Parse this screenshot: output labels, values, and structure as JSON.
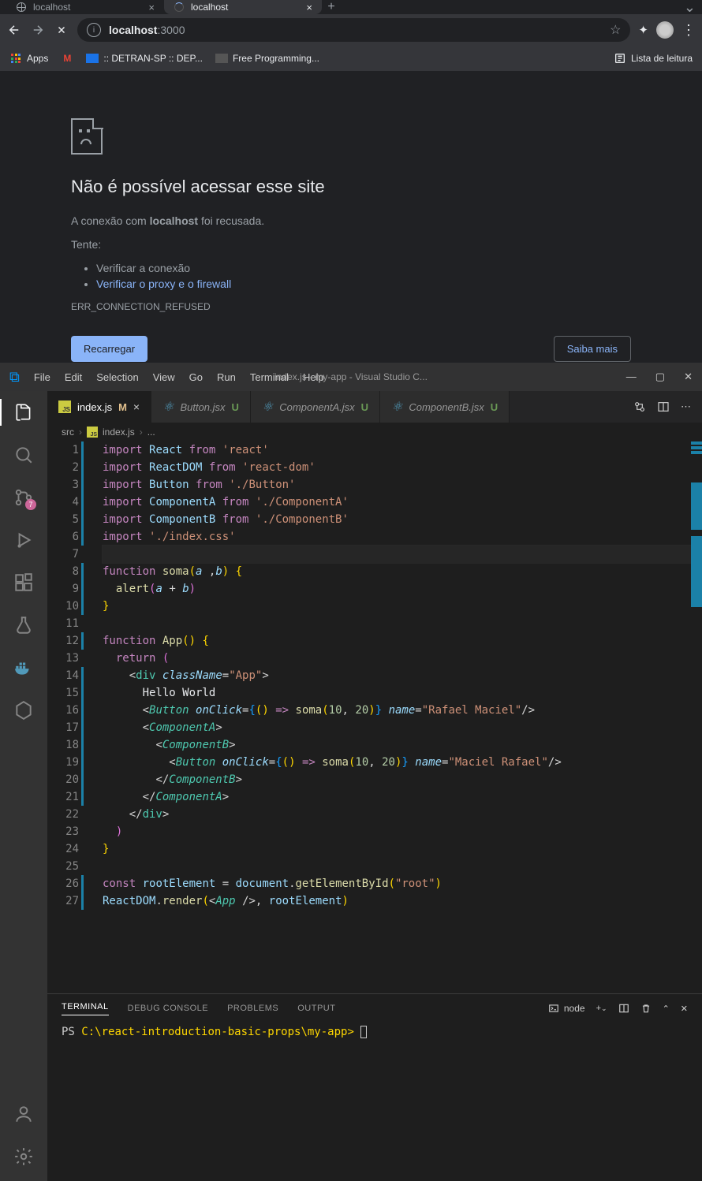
{
  "chrome": {
    "tabs": [
      {
        "title": "localhost",
        "active": false
      },
      {
        "title": "localhost",
        "active": true
      }
    ],
    "url_host": "localhost",
    "url_port": ":3000",
    "bookmarks": {
      "apps": "Apps",
      "detran": ":: DETRAN-SP :: DEP...",
      "freeprog": "Free Programming...",
      "readlist": "Lista de leitura"
    }
  },
  "error": {
    "title": "Não é possível acessar esse site",
    "msg_pre": "A conexão com ",
    "msg_host": "localhost",
    "msg_post": " foi recusada.",
    "try": "Tente:",
    "bullets": [
      "Verificar a conexão",
      "Verificar o proxy e o firewall"
    ],
    "code": "ERR_CONNECTION_REFUSED",
    "reload": "Recarregar",
    "more": "Saiba mais"
  },
  "vscode": {
    "menu": [
      "File",
      "Edit",
      "Selection",
      "View",
      "Go",
      "Run",
      "Terminal",
      "Help"
    ],
    "wintitle": "index.js - my-app - Visual Studio C...",
    "scm_badge": "7",
    "tabs": [
      {
        "name": "index.js",
        "status": "M",
        "active": true,
        "icon": "js"
      },
      {
        "name": "Button.jsx",
        "status": "U",
        "active": false,
        "icon": "react"
      },
      {
        "name": "ComponentA.jsx",
        "status": "U",
        "active": false,
        "icon": "react"
      },
      {
        "name": "ComponentB.jsx",
        "status": "U",
        "active": false,
        "icon": "react"
      }
    ],
    "breadcrumb": [
      "src",
      "index.js",
      "..."
    ],
    "terminal": {
      "tabs": [
        "TERMINAL",
        "DEBUG CONSOLE",
        "PROBLEMS",
        "OUTPUT"
      ],
      "shell": "node",
      "prompt_prefix": "PS ",
      "prompt_path": "C:\\react-introduction-basic-props\\my-app>"
    },
    "code_strings": {
      "react": "'react'",
      "reactdom": "'react-dom'",
      "button_path": "'./Button'",
      "compA_path": "'./ComponentA'",
      "compB_path": "'./ComponentB'",
      "css": "'./index.css'",
      "app_class": "\"App\"",
      "hello": "Hello World",
      "name1": "\"Rafael Maciel\"",
      "name2": "\"Maciel Rafael\"",
      "root": "\"root\"",
      "n10": "10",
      "n20": "20"
    }
  }
}
